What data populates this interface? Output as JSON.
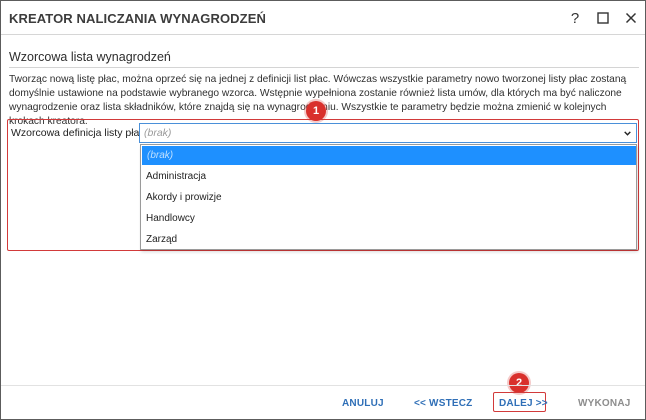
{
  "window": {
    "title": "KREATOR NALICZANIA WYNAGRODZEŃ",
    "help_icon": "?",
    "maximize_icon": "☐",
    "close_icon": "✕"
  },
  "section": {
    "title": "Wzorcowa lista wynagrodzeń",
    "description": "Tworząc nową listę płac, można oprzeć się na jednej z definicji list płac. Wówczas wszystkie parametry nowo tworzonej listy płac zostaną domyślnie ustawione na podstawie wybranego wzorca. Wstępnie wypełniona zostanie również lista umów, dla których ma być naliczone wynagrodzenie oraz lista składników, które znajdą się na wynagrodzeniu. Wszystkie te parametry będzie można zmienić w kolejnych krokach kreatora."
  },
  "field": {
    "label": "Wzorcowa definicja listy płac:",
    "value": "(brak)",
    "options": [
      "(brak)",
      "Administracja",
      "Akordy i prowizje",
      "Handlowcy",
      "Zarząd"
    ],
    "selected_index": 0
  },
  "badges": [
    "1",
    "2"
  ],
  "footer": {
    "cancel": "ANULUJ",
    "back": "<< WSTECZ",
    "next": "DALEJ >>",
    "finish": "WYKONAJ"
  },
  "colors": {
    "accent": "#2f6fb7",
    "highlight": "#d23a3a",
    "selected_option": "#1e90ff",
    "disabled": "#8d8d8d"
  }
}
